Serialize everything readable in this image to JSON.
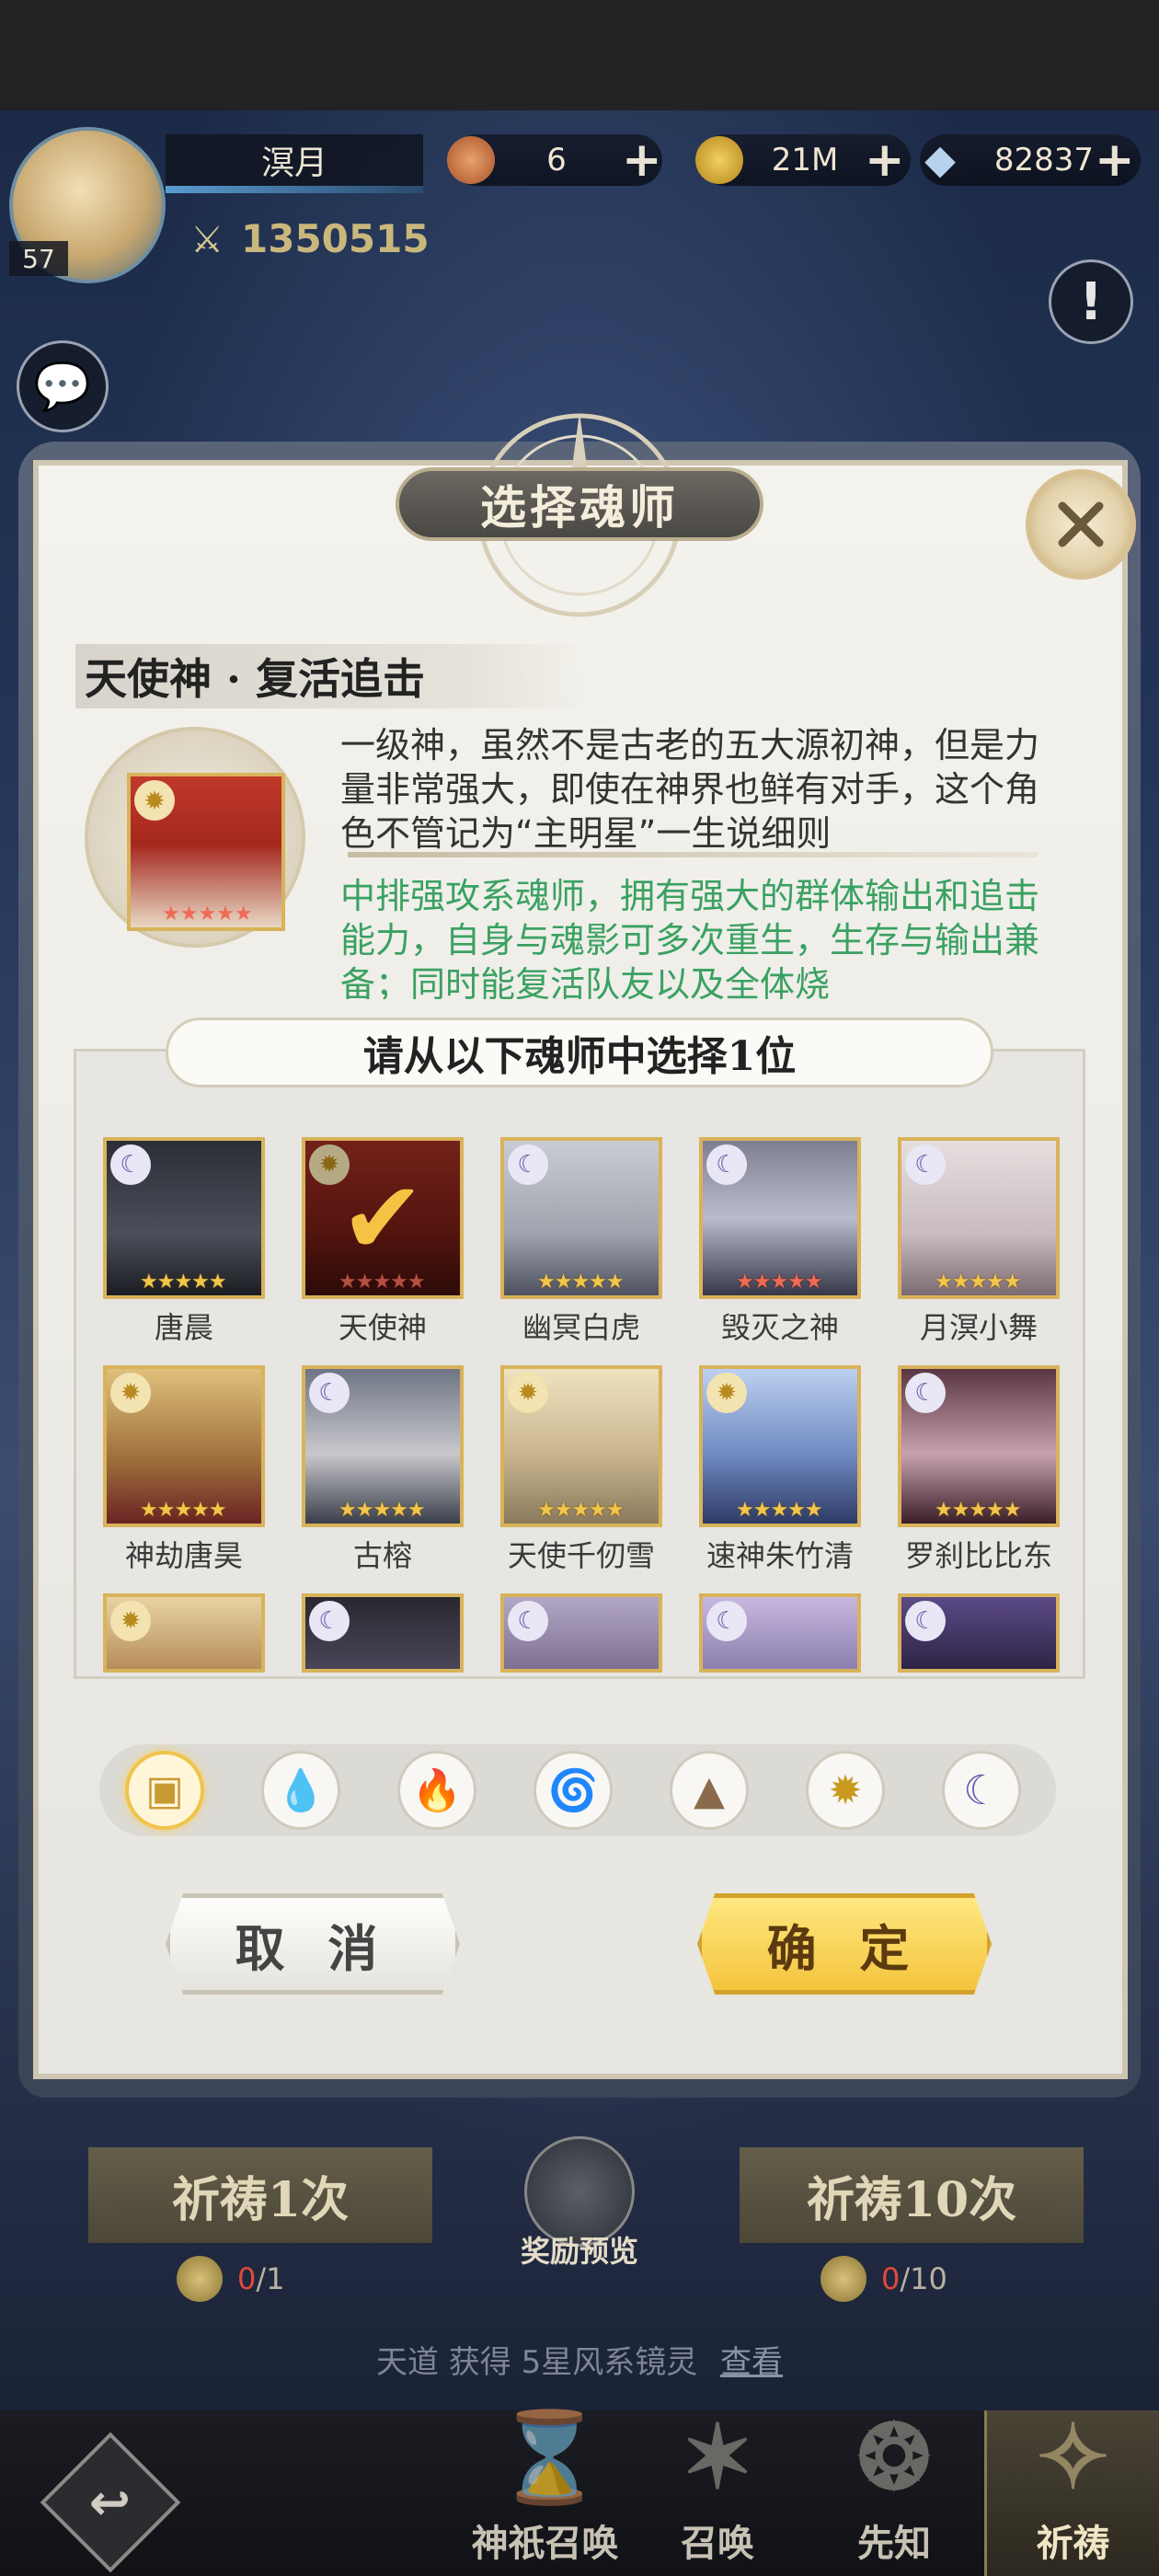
{
  "player": {
    "name": "溟月",
    "level": "57",
    "power": "1350515"
  },
  "resources": [
    {
      "icon": "currency-orb-icon",
      "value": "6"
    },
    {
      "icon": "gold-coin-icon",
      "value": "21M"
    },
    {
      "icon": "diamond-icon",
      "value": "82837"
    }
  ],
  "modal": {
    "title": "选择魂师",
    "skill_title": "天使神 · 复活追击",
    "description": "一级神，虽然不是古老的五大源初神，但是力量非常强大，即使在神界也鲜有对手，这个角色不管记为“主明星”一生说细则",
    "highlight": "中排强攻系魂师，拥有强大的群体输出和追击能力，自身与魂影可多次重生，生存与输出兼备；同时能复活队友以及全体烧",
    "list_header": "请从以下魂师中选择1位",
    "cancel_label": "取 消",
    "confirm_label": "确 定"
  },
  "characters": [
    {
      "name": "唐晨",
      "element": "moon-icon",
      "stars": "★★★★★",
      "star_color": "gold",
      "selected": false
    },
    {
      "name": "天使神",
      "element": "sun-icon",
      "stars": "★★★★★",
      "star_color": "red",
      "selected": true
    },
    {
      "name": "幽冥白虎",
      "element": "moon-icon",
      "stars": "★★★★★",
      "star_color": "gold",
      "selected": false
    },
    {
      "name": "毁灭之神",
      "element": "moon-icon",
      "stars": "★★★★★",
      "star_color": "red",
      "selected": false
    },
    {
      "name": "月溟小舞",
      "element": "moon-icon",
      "stars": "★★★★★",
      "star_color": "gold",
      "selected": false
    },
    {
      "name": "神劫唐昊",
      "element": "sun-icon",
      "stars": "★★★★★",
      "star_color": "gold",
      "selected": false
    },
    {
      "name": "古榕",
      "element": "moon-icon",
      "stars": "★★★★★",
      "star_color": "gold",
      "selected": false
    },
    {
      "name": "天使千仞雪",
      "element": "sun-icon",
      "stars": "★★★★★",
      "star_color": "gold",
      "selected": false
    },
    {
      "name": "速神朱竹清",
      "element": "sun-icon",
      "stars": "★★★★★",
      "star_color": "gold",
      "selected": false
    },
    {
      "name": "罗刹比比东",
      "element": "moon-icon",
      "stars": "★★★★★",
      "star_color": "gold",
      "selected": false
    },
    {
      "name": "",
      "element": "sun-icon",
      "stars": "",
      "star_color": "gold",
      "selected": false
    },
    {
      "name": "",
      "element": "moon-icon",
      "stars": "",
      "star_color": "gold",
      "selected": false
    },
    {
      "name": "",
      "element": "moon-icon",
      "stars": "",
      "star_color": "gold",
      "selected": false
    },
    {
      "name": "",
      "element": "moon-icon",
      "stars": "",
      "star_color": "gold",
      "selected": false
    },
    {
      "name": "",
      "element": "moon-icon",
      "stars": "",
      "star_color": "gold",
      "selected": false
    }
  ],
  "filters": [
    {
      "icon": "all-box-icon",
      "active": true
    },
    {
      "icon": "water-drop-icon",
      "active": false
    },
    {
      "icon": "fire-icon",
      "active": false
    },
    {
      "icon": "wind-icon",
      "active": false
    },
    {
      "icon": "earth-mountain-icon",
      "active": false
    },
    {
      "icon": "sun-icon",
      "active": false
    },
    {
      "icon": "moon-icon",
      "active": false
    }
  ],
  "pray": {
    "once_label": "祈祷1次",
    "ten_label": "祈祷10次",
    "once_cost_have": "0",
    "once_cost_need": "/1",
    "ten_cost_have": "0",
    "ten_cost_need": "/10",
    "reward_preview_label": "奖励预览",
    "broadcast_text": "天道 获得 5星风系镜灵",
    "broadcast_link": "查看"
  },
  "nav": [
    {
      "icon": "back-arrow-icon",
      "label": ""
    },
    {
      "icon": "hourglass-icon",
      "label": "神祇召唤"
    },
    {
      "icon": "star-summon-icon",
      "label": "召唤"
    },
    {
      "icon": "prophet-icon",
      "label": "先知"
    },
    {
      "icon": "pray-icon",
      "label": "祈祷"
    }
  ],
  "colors": {
    "accent_gold": "#f4c53d",
    "highlight_green": "#3aa162",
    "cost_red": "#e04a3a"
  }
}
